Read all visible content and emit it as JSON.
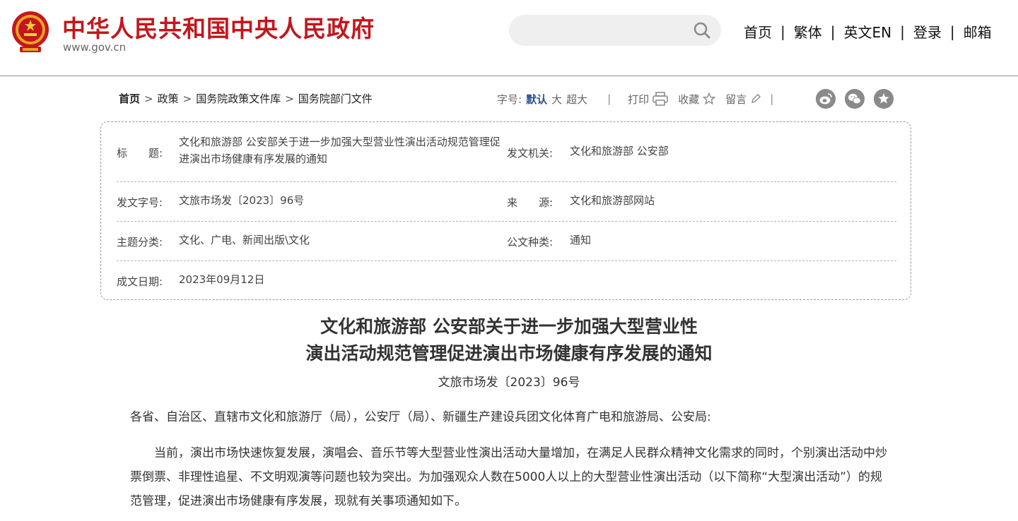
{
  "header": {
    "site_title": "中华人民共和国中央人民政府",
    "site_url": "www.gov.cn",
    "search_placeholder": "",
    "nav": [
      "首页",
      "繁体",
      "英文EN",
      "登录",
      "邮箱"
    ],
    "nav_separator": "|"
  },
  "breadcrumb": {
    "items": [
      "首页",
      "政策",
      "国务院政策文件库",
      "国务院部门文件"
    ],
    "separator": ">"
  },
  "toolbar": {
    "font_size_label": "字号:",
    "font_sizes": [
      "默认",
      "大",
      "超大"
    ],
    "separator": "|",
    "print": "打印",
    "favorite": "收藏",
    "comment": "留言",
    "share_icons": [
      "weibo-icon",
      "wechat-icon",
      "star-share-icon"
    ]
  },
  "info": {
    "title_label": "标　　题:",
    "title_value": "文化和旅游部 公安部关于进一步加强大型营业性演出活动规范管理促进演出市场健康有序发展的通知",
    "issuer_label": "发文机关:",
    "issuer_value": "文化和旅游部 公安部",
    "doc_no_label": "发文字号:",
    "doc_no_value": "文旅市场发〔2023〕96号",
    "source_label": "来　　源:",
    "source_value": "文化和旅游部网站",
    "topic_label": "主题分类:",
    "topic_value": "文化、广电、新闻出版\\文化",
    "type_label": "公文种类:",
    "type_value": "通知",
    "date_label": "成文日期:",
    "date_value": "2023年09月12日"
  },
  "article": {
    "title_line1": "文化和旅游部 公安部关于进一步加强大型营业性",
    "title_line2": "演出活动规范管理促进演出市场健康有序发展的通知",
    "doc_no": "文旅市场发〔2023〕96号",
    "salutation": "各省、自治区、直辖市文化和旅游厅（局），公安厅（局）、新疆生产建设兵团文化体育广电和旅游局、公安局:",
    "body_p1": "　　当前，演出市场快速恢复发展，演唱会、音乐节等大型营业性演出活动大量增加，在满足人民群众精神文化需求的同时，个别演出活动中炒票倒票、非理性追星、不文明观演等问题也较为突出。为加强观众人数在5000人以上的大型营业性演出活动（以下简称“大型演出活动”）的规范管理，促进演出市场健康有序发展，现就有关事项通知如下。"
  },
  "colors": {
    "brand_red": "#c4161c",
    "active_blue": "#2b5297",
    "text": "#333333"
  }
}
